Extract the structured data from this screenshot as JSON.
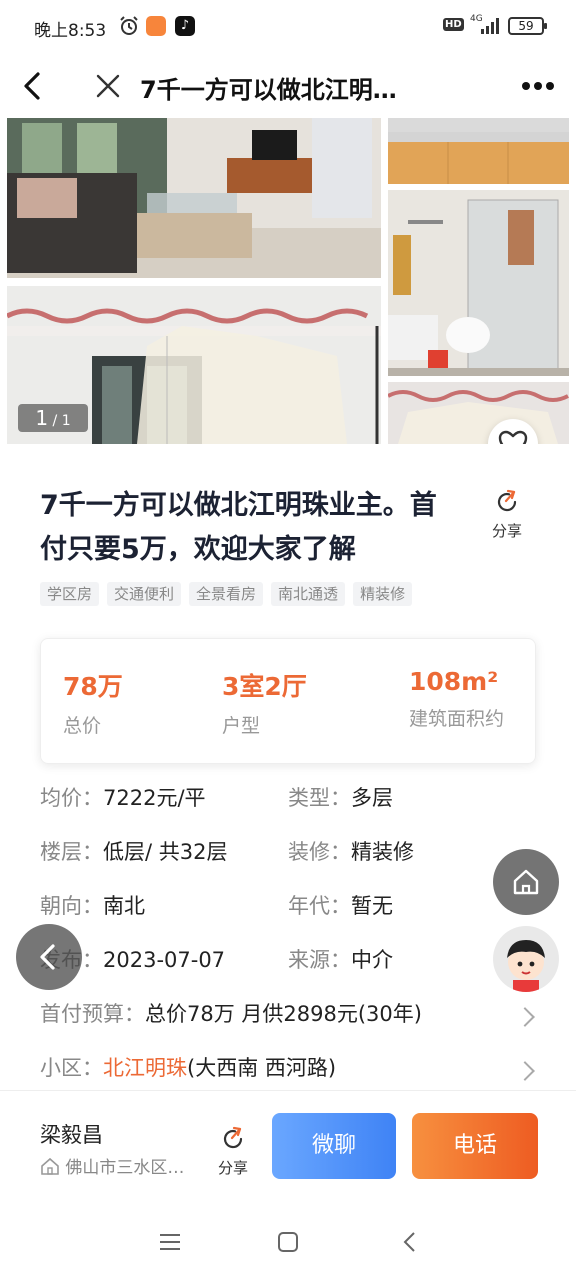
{
  "status_bar": {
    "time": "晚上8:53",
    "alarm_icon": "alarm-clock-icon",
    "hd_label": "HD",
    "network_label": "4G",
    "battery": "59"
  },
  "nav": {
    "title": "7千一方可以做北江明…",
    "back_icon": "back-arrow-icon",
    "close_icon": "close-icon",
    "more_icon": "more-dots-icon"
  },
  "gallery": {
    "counter_current": "1",
    "counter_total": "/ 1"
  },
  "listing": {
    "title": "7千一方可以做北江明珠业主。首付只要5万，欢迎大家了解",
    "share_label": "分享",
    "tags": [
      "学区房",
      "交通便利",
      "全景看房",
      "南北通透",
      "精装修"
    ]
  },
  "summary": [
    {
      "value": "78万",
      "label": "总价"
    },
    {
      "value": "3室2厅",
      "label": "户型"
    },
    {
      "value": "108m²",
      "label": "建筑面积约"
    }
  ],
  "details": {
    "unit_price": {
      "key": "均价：",
      "value": "7222元/平"
    },
    "type": {
      "key": "类型：",
      "value": "多层"
    },
    "floor": {
      "key": "楼层：",
      "value": "低层/ 共32层"
    },
    "decoration": {
      "key": "装修：",
      "value": "精装修"
    },
    "orientation": {
      "key": "朝向：",
      "value": "南北"
    },
    "year": {
      "key": "年代：",
      "value": "暂无"
    },
    "published": {
      "key": "发布：",
      "value": "2023-07-07"
    },
    "source": {
      "key": "来源：",
      "value": "中介"
    },
    "budget": {
      "key": "首付预算：",
      "value": "总价78万 月供2898元(30年)"
    },
    "community": {
      "key": "小区：",
      "link": "北江明珠",
      "rest": "(大西南 西河路)"
    }
  },
  "bottom_bar": {
    "agent_name": "梁毅昌",
    "agent_location": "佛山市三水区…",
    "share_label": "分享",
    "chat_label": "微聊",
    "call_label": "电话"
  },
  "colors": {
    "accent_orange": "#ec6935",
    "chat_blue": "#3f83f5",
    "call_orange": "#ee5c22"
  }
}
